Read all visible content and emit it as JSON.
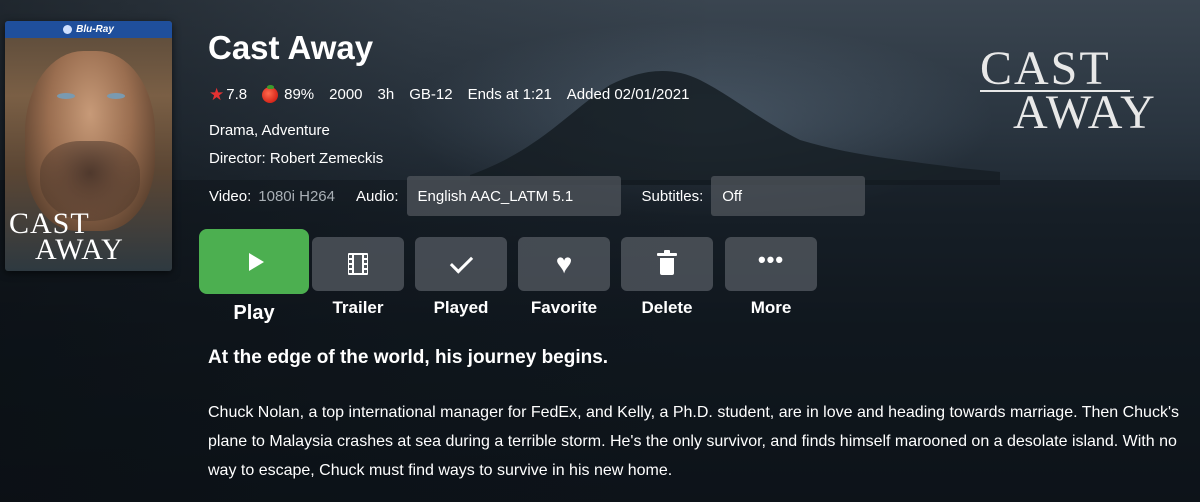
{
  "movie": {
    "title": "Cast Away",
    "tagline": "At the edge of the world, his journey begins.",
    "overview": "Chuck Nolan, a top international manager for FedEx, and Kelly, a Ph.D. student, are in love and heading towards marriage. Then Chuck's plane to Malaysia crashes at sea during a terrible storm. He's the only survivor, and finds himself marooned on a desolate island. With no way to escape, Chuck must find ways to survive in his new home."
  },
  "poster": {
    "badge": "Blu-Ray",
    "title_line1": "CAST",
    "title_line2": "AWAY"
  },
  "logo": {
    "line1": "CAST",
    "line2": "AWAY"
  },
  "meta": {
    "community_rating": "7.8",
    "critic_rating": "89%",
    "year": "2000",
    "runtime": "3h",
    "official_rating": "GB-12",
    "ends_at": "Ends at 1:21",
    "added": "Added 02/01/2021"
  },
  "genres": "Drama, Adventure",
  "director": "Director: Robert Zemeckis",
  "media": {
    "video_label": "Video:",
    "video_value": "1080i H264",
    "audio_label": "Audio:",
    "audio_value": "English AAC_LATM 5.1",
    "subtitles_label": "Subtitles:",
    "subtitles_value": "Off"
  },
  "buttons": {
    "play": "Play",
    "trailer": "Trailer",
    "played": "Played",
    "favorite": "Favorite",
    "delete": "Delete",
    "more": "More"
  },
  "icons": {
    "rating": "star-icon",
    "critic": "tomato-icon",
    "play": "play-icon",
    "trailer": "film-icon",
    "played": "check-icon",
    "favorite": "heart-icon",
    "delete": "trash-icon",
    "more": "more-dots-icon"
  },
  "colors": {
    "play_button": "#4caf50",
    "star": "#e53232",
    "poster_badge": "#1f4f9c"
  }
}
